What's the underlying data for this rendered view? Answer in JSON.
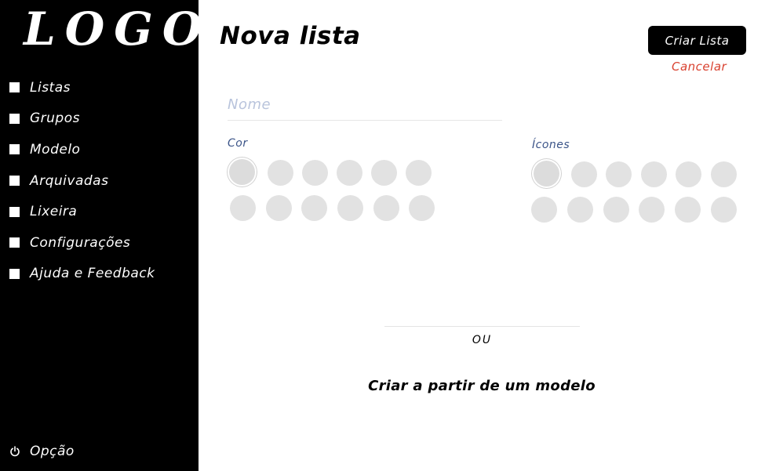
{
  "sidebar": {
    "logo": "LOGO",
    "items": [
      {
        "label": "Listas"
      },
      {
        "label": "Grupos"
      },
      {
        "label": "Modelo"
      },
      {
        "label": "Arquivadas"
      },
      {
        "label": "Lixeira"
      },
      {
        "label": "Configurações"
      },
      {
        "label": "Ajuda e Feedback"
      }
    ],
    "option_label": "Opção",
    "option_icon": "power-icon"
  },
  "header": {
    "title": "Nova lista",
    "create_label": "Criar Lista",
    "cancel_label": "Cancelar"
  },
  "form": {
    "name_placeholder": "Nome",
    "name_value": "",
    "color_label": "Cor",
    "icons_label": "Ícones"
  },
  "footer": {
    "or_label": "OU",
    "template_label": "Criar a partir de um modelo"
  },
  "colors": {
    "sidebar_bg": "#000000",
    "cancel": "#d9412f",
    "section_label": "#3b5488",
    "placeholder": "#b9c4dc",
    "swatch": "#e2e2e2"
  }
}
